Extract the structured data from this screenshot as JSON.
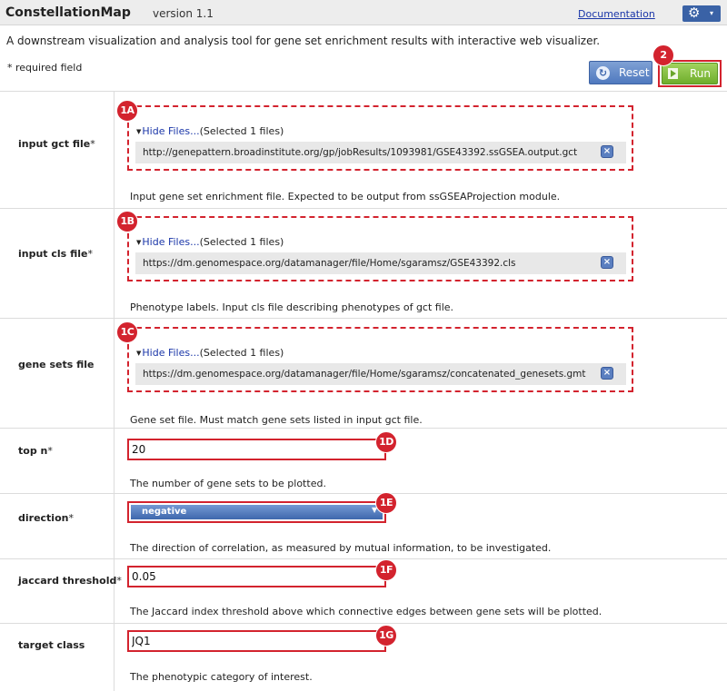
{
  "header": {
    "app_title": "ConstellationMap",
    "version": "version 1.1",
    "documentation_link": "Documentation",
    "gear_icon": "gear-icon",
    "caret": "▾"
  },
  "description": "A downstream visualization and analysis tool for gene set enrichment results with interactive web visualizer.",
  "required_note": "* required field",
  "buttons": {
    "reset": "Reset",
    "run": "Run"
  },
  "badges": {
    "run": "2",
    "gct": "1A",
    "cls": "1B",
    "genesets": "1C",
    "topn": "1D",
    "direction": "1E",
    "jaccard": "1F",
    "target": "1G"
  },
  "params": {
    "gct": {
      "label": "input gct file",
      "required_mark": "*",
      "hide_files": "Hide Files...",
      "selected": "(Selected 1 files)",
      "file_url": "http://genepattern.broadinstitute.org/gp/jobResults/1093981/GSE43392.ssGSEA.output.gct",
      "description": "Input gene set enrichment file. Expected to be output from ssGSEAProjection module."
    },
    "cls": {
      "label": "input cls file",
      "required_mark": "*",
      "hide_files": "Hide Files...",
      "selected": "(Selected 1 files)",
      "file_url": "https://dm.genomespace.org/datamanager/file/Home/sgaramsz/GSE43392.cls",
      "description": "Phenotype labels. Input cls file describing phenotypes of gct file."
    },
    "genesets": {
      "label": "gene sets file",
      "hide_files": "Hide Files...",
      "selected": "(Selected 1 files)",
      "file_url": "https://dm.genomespace.org/datamanager/file/Home/sgaramsz/concatenated_genesets.gmt",
      "description": "Gene set file. Must match gene sets listed in input gct file."
    },
    "topn": {
      "label": "top n",
      "required_mark": "*",
      "value": "20",
      "description": "The number of gene sets to be plotted."
    },
    "direction": {
      "label": "direction",
      "required_mark": "*",
      "value": "negative",
      "description": "The direction of correlation, as measured by mutual information, to be investigated."
    },
    "jaccard": {
      "label": "jaccard threshold",
      "required_mark": "*",
      "value": "0.05",
      "description": "The Jaccard index threshold above which connective edges between gene sets will be plotted."
    },
    "target": {
      "label": "target class",
      "value": "JQ1",
      "description": "The phenotypic category of interest."
    }
  },
  "colors": {
    "highlight_red": "#d3232e",
    "accent_blue": "#3a62a6",
    "run_green": "#6fae2c",
    "link_blue": "#1a36a8"
  }
}
